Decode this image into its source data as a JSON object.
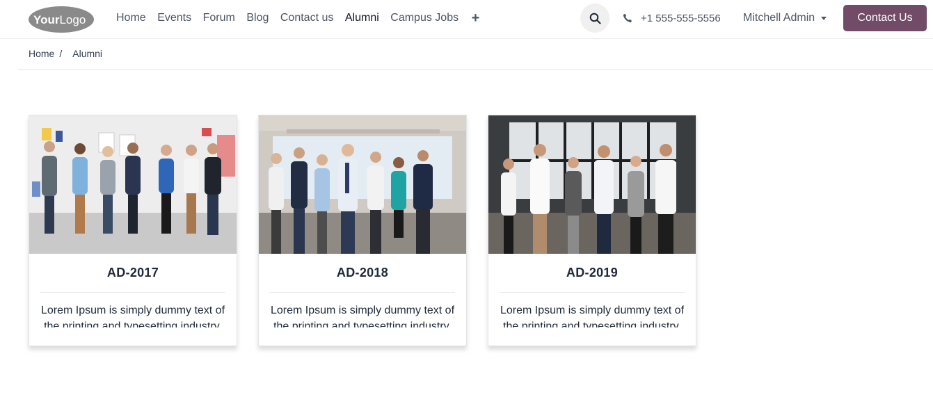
{
  "brand": {
    "logo_text_bold": "Your",
    "logo_text": "Logo"
  },
  "nav": {
    "items": [
      {
        "label": "Home",
        "active": false
      },
      {
        "label": "Events",
        "active": false
      },
      {
        "label": "Forum",
        "active": false
      },
      {
        "label": "Blog",
        "active": false
      },
      {
        "label": "Contact us",
        "active": false
      },
      {
        "label": "Alumni",
        "active": true
      },
      {
        "label": "Campus Jobs",
        "active": false
      }
    ],
    "plus_icon": "+"
  },
  "header": {
    "search_icon": "search-icon",
    "phone": "+1 555-555-5556",
    "user_name": "Mitchell Admin",
    "cta_label": "Contact Us",
    "cta_color": "#714b67"
  },
  "breadcrumb": {
    "home": "Home",
    "separator": "/",
    "current": "Alumni"
  },
  "cards": [
    {
      "title": "AD-2017",
      "text": "Lorem Ipsum is simply dummy text of the printing and typesetting industry."
    },
    {
      "title": "AD-2018",
      "text": "Lorem Ipsum is simply dummy text of the printing and typesetting industry."
    },
    {
      "title": "AD-2019",
      "text": "Lorem Ipsum is simply dummy text of the printing and typesetting industry."
    }
  ]
}
